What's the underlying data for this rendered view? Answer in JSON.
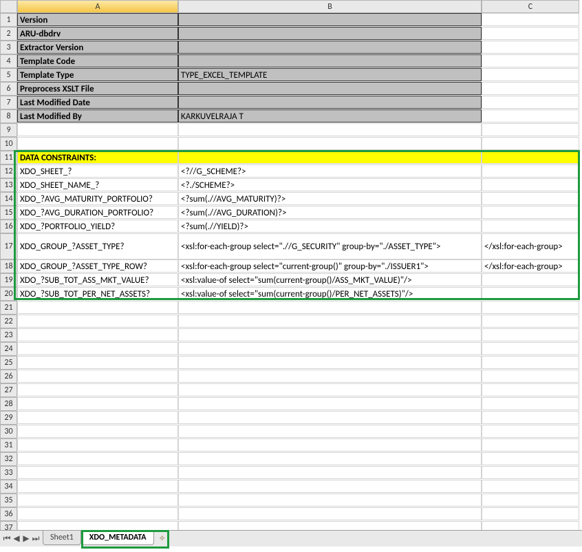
{
  "cols": [
    "A",
    "B",
    "C"
  ],
  "rowsMeta": [
    {
      "n": 1,
      "a": "Version",
      "b": "",
      "grey": true
    },
    {
      "n": 2,
      "a": "ARU-dbdrv",
      "b": "",
      "grey": true
    },
    {
      "n": 3,
      "a": "Extractor Version",
      "b": "",
      "grey": true
    },
    {
      "n": 4,
      "a": "Template Code",
      "b": "",
      "grey": true
    },
    {
      "n": 5,
      "a": "Template Type",
      "b": "TYPE_EXCEL_TEMPLATE",
      "grey": true
    },
    {
      "n": 6,
      "a": "Preprocess XSLT File",
      "b": "",
      "grey": true
    },
    {
      "n": 7,
      "a": "Last Modified Date",
      "b": "",
      "grey": true
    },
    {
      "n": 8,
      "a": "Last Modified By",
      "b": "KARKUVELRAJA T",
      "grey": true
    }
  ],
  "blankRows1": [
    9,
    10
  ],
  "constraintHeader": {
    "n": 11,
    "a": "DATA CONSTRAINTS:"
  },
  "constraints": [
    {
      "n": 12,
      "a": "XDO_SHEET_?",
      "b": "<?//G_SCHEME?>",
      "c": ""
    },
    {
      "n": 13,
      "a": "XDO_SHEET_NAME_?",
      "b": "<?./SCHEME?>",
      "c": ""
    },
    {
      "n": 14,
      "a": "XDO_?AVG_MATURITY_PORTFOLIO?",
      "b": "<?sum(.//AVG_MATURITY)?>",
      "c": ""
    },
    {
      "n": 15,
      "a": "XDO_?AVG_DURATION_PORTFOLIO?",
      "b": "<?sum(.//AVG_DURATION)?>",
      "c": ""
    },
    {
      "n": 16,
      "a": "XDO_?PORTFOLIO_YIELD?",
      "b": "<?sum(.//YIELD)?>",
      "c": ""
    }
  ],
  "constraints2": [
    {
      "n": 17,
      "a": "XDO_GROUP_?ASSET_TYPE?",
      "b": "<xsl:for-each-group select=\".//G_SECURITY\" group-by=\"./ASSET_TYPE\">",
      "c": "</xsl:for-each-group>",
      "tall": true
    },
    {
      "n": 18,
      "a": "XDO_GROUP_?ASSET_TYPE_ROW?",
      "b": "<xsl:for-each-group select=\"current-group()\" group-by=\"./ISSUER1\">",
      "c": "</xsl:for-each-group>"
    },
    {
      "n": 19,
      "a": "XDO_?SUB_TOT_ASS_MKT_VALUE?",
      "b": "<xsl:value-of select=\"sum(current-group()/ASS_MKT_VALUE)\"/>",
      "c": ""
    },
    {
      "n": 20,
      "a": "XDO_?SUB_TOT_PER_NET_ASSETS?",
      "b": "<xsl:value-of select=\"sum(current-group()/PER_NET_ASSETS)\"/>",
      "c": ""
    }
  ],
  "blankRows2": [
    21,
    22,
    23,
    24,
    25,
    26,
    27,
    28,
    29,
    30,
    31,
    32,
    33,
    34,
    35,
    36,
    37
  ],
  "tabs": {
    "sheet1": "Sheet1",
    "active": "XDO_METADATA"
  },
  "nav": {
    "first": "⏮",
    "prev": "◀",
    "next": "▶",
    "last": "⏭"
  }
}
